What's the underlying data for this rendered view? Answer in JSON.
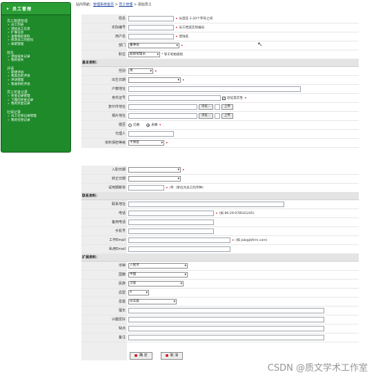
{
  "sidebar": {
    "title": "员工管理",
    "sections": [
      {
        "label": "员工数据管理",
        "items": [
          "员工列表",
          "添加员工信息",
          "扩展信息",
          "查看我的资料",
          "修改员工的密码",
          "离职管理"
        ]
      },
      {
        "label": "技失",
        "items": [
          "添加技失记录",
          "我的技失"
        ]
      },
      {
        "label": "评语",
        "items": [
          "新建评语",
          "我发出的评语",
          "评语管理",
          "我收到的评语"
        ]
      },
      {
        "label": "员工奖金记录",
        "items": [
          "奖金记录管理",
          "下属的奖金记录",
          "我的奖金记录"
        ]
      },
      {
        "label": "社保记录",
        "items": [
          "员工社保记录管理",
          "我的社保记录"
        ]
      }
    ]
  },
  "breadcrumb": {
    "prefix": "站内导航：",
    "link1": "管理系统首页",
    "sep1": " > ",
    "link2": "员工管理",
    "sep2": " > ",
    "current": "添加员工"
  },
  "form": {
    "name_label": "姓名",
    "name_hint": "长度在 2-20个字符之间",
    "code_label": "实际编号",
    "code_hint": "员工档案实际编号",
    "user_label": "用户名",
    "user_hint": "登陆名",
    "dept_label": "部门",
    "dept_value": "董事会",
    "role_label": "职位",
    "role_value": "超级管理员",
    "role_hint": "* 等于初始级别",
    "basic_section": "基本资料：",
    "gender_label": "性别",
    "gender_value": "男",
    "birth_label": "出生日期",
    "hukou_label": "户籍地址",
    "idcard_label": "身份证号",
    "idcard_check": "验证其实性",
    "copy_label": "复印件地址",
    "browse": "浏览...",
    "upload": "上传",
    "photo_label": "相片地址",
    "marry_label": "婚否",
    "married": "已婚",
    "single": "未婚",
    "agent_label": "代理人",
    "secret_label": "资料保密等级",
    "secret_value": "不保密",
    "entry_label": "入职日期",
    "regular_label": "转正日期",
    "salary_label": "试用期薪资",
    "salary_hint": "/月（单位为员工的币种）",
    "contact_section": "联系资料：",
    "address_label": "联系地址",
    "phone_label": "电话",
    "phone_hint": "(如 86-29-078541245)",
    "phone2_label": "备用电话",
    "mobile_label": "手机号",
    "email_label": "工作Email",
    "email_hint": "(如 job@jbfirm.com)",
    "email2_label": "私用Email",
    "ext_section": "扩展资料：",
    "currency_label": "币种",
    "currency_value": "人民币",
    "country_label": "国籍",
    "country_value": "中国",
    "nation_label": "民族",
    "nation_value": "汉族",
    "blood_label": "血型",
    "blood_value": "A",
    "star_label": "星座",
    "star_value": "白羊座",
    "skill_label": "擅长",
    "hobby_label": "兴趣爱好",
    "weak_label": "缺点",
    "note_label": "备注",
    "ok_button": "确 定",
    "cancel_button": "取 消"
  },
  "watermark": "CSDN @质文学术工作室"
}
